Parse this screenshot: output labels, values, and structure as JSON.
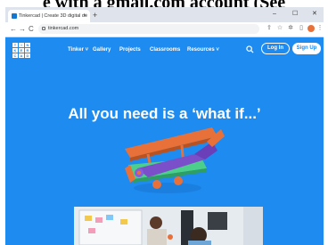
{
  "caption": "e with a gmail.com account (See",
  "browser": {
    "tab_title": "Tinkercad | Create 3D digital de",
    "tab_close": "×",
    "new_tab": "+",
    "window_controls": [
      "–",
      "☐",
      "✕"
    ],
    "url": "tinkercad.com",
    "back": "←",
    "forward": "→",
    "reload": "C"
  },
  "site": {
    "logo_letters": [
      "T",
      "I",
      "N",
      "K",
      "E",
      "R",
      "C",
      "A",
      "D"
    ],
    "nav": {
      "tinker": "Tinker ˅",
      "gallery": "Gallery",
      "projects": "Projects",
      "classrooms": "Classrooms",
      "resources": "Resources ˅"
    },
    "login": "Log In",
    "signup": "Sign Up",
    "hero_title": "All you need is a ‘what if...’"
  },
  "colors": {
    "brand_blue": "#1d8bf0",
    "tabbar": "#dfe3eb",
    "plane_orange": "#e8713a",
    "plane_green": "#4ccf8a",
    "plane_purple": "#7b4fc9"
  }
}
